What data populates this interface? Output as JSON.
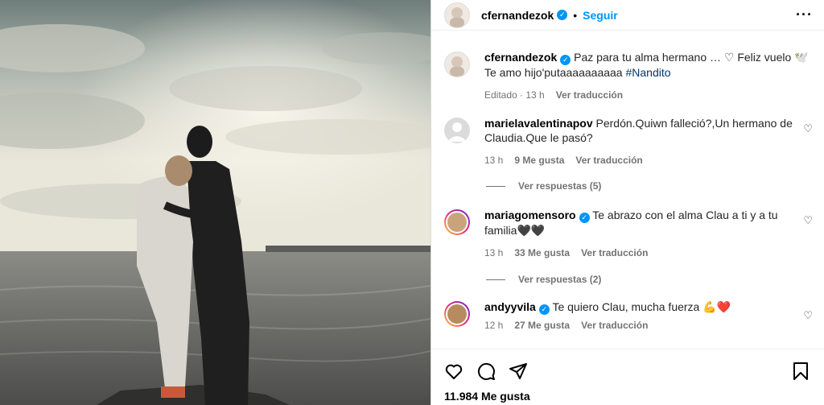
{
  "header": {
    "username": "cfernandezok",
    "separator": "•",
    "follow_label": "Seguir",
    "more_icon": "more-horizontal-icon"
  },
  "caption": {
    "username": "cfernandezok",
    "text": "Paz para tu alma hermano … ♡ Feliz vuelo 🕊️ Te amo hijo'putaaaaaaaaaa",
    "hashtag": "#Nandito",
    "time": "Editado · 13 h",
    "translate": "Ver traducción"
  },
  "comments": [
    {
      "username": "marielavalentinapov",
      "text": "Perdón.Quiwn falleció?,Un hermano de Claudia.Que le pasó?",
      "time": "13 h",
      "likes": "9 Me gusta",
      "translate": "Ver traducción",
      "replies": "Ver respuestas (5)"
    },
    {
      "username": "mariagomensoro",
      "text": "Te abrazo con el alma Clau a ti y a tu familia🖤🖤",
      "time": "13 h",
      "likes": "33 Me gusta",
      "translate": "Ver traducción",
      "replies": "Ver respuestas (2)"
    },
    {
      "username": "andyyvila",
      "text": "Te quiero Clau, mucha fuerza 💪❤️",
      "time": "12 h",
      "likes": "27 Me gusta",
      "translate": "Ver traducción"
    }
  ],
  "actions": {
    "like_icon": "heart-icon",
    "comment_icon": "comment-icon",
    "share_icon": "share-icon",
    "save_icon": "bookmark-icon",
    "likes_count": "11.984 Me gusta"
  },
  "colors": {
    "accent": "#0095f6",
    "verified": "#0095f6",
    "muted": "#737373",
    "hashtag": "#00376b"
  }
}
